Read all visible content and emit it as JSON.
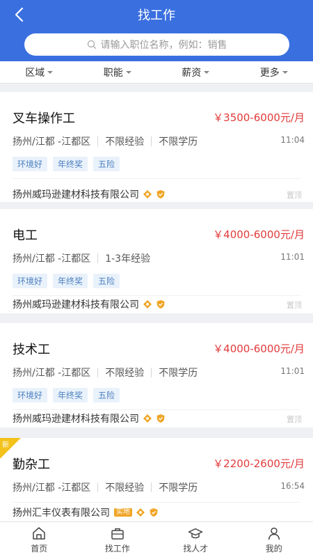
{
  "header": {
    "title": "找工作"
  },
  "search": {
    "placeholder": "请输入职位名称，例如：销售"
  },
  "filters": [
    "区域",
    "职能",
    "薪资",
    "更多"
  ],
  "jobs": [
    {
      "title": "叉车操作工",
      "salary": "￥3500-6000元/月",
      "location": "扬州/江都 -江都区",
      "experience": "不限经验",
      "education": "不限学历",
      "time": "11:04",
      "tags": [
        "环境好",
        "年终奖",
        "五险"
      ],
      "company": "扬州威玛逊建材科技有限公司",
      "pin": "置顶"
    },
    {
      "title": "电工",
      "salary": "￥4000-6000元/月",
      "location": "扬州/江都 -江都区",
      "experience": "1-3年经验",
      "time": "11:01",
      "tags": [
        "环境好",
        "年终奖",
        "五险"
      ],
      "company": "扬州威玛逊建材科技有限公司",
      "pin": "置顶"
    },
    {
      "title": "技术工",
      "salary": "￥4000-6000元/月",
      "location": "扬州/江都 -江都区",
      "experience": "不限经验",
      "education": "不限学历",
      "time": "11:01",
      "tags": [
        "环境好",
        "年终奖",
        "五险"
      ],
      "company": "扬州威玛逊建材科技有限公司",
      "pin": "置顶"
    },
    {
      "title": "勤杂工",
      "salary": "￥2200-2600元/月",
      "location": "扬州/江都 -江都区",
      "experience": "不限经验",
      "education": "不限学历",
      "time": "16:54",
      "company": "扬州汇丰仪表有限公司",
      "new_label": "新",
      "company_tag": "实地"
    }
  ],
  "tabbar": [
    "首页",
    "找工作",
    "找人才",
    "我的"
  ],
  "colors": {
    "primary": "#3a6fe0",
    "salary": "#e23a3a",
    "tag_bg": "#e9f2fb",
    "tag_text": "#4d7fbf",
    "badge": "#f0a526"
  },
  "icons": [
    "back-arrow-icon",
    "search-icon",
    "home-icon",
    "briefcase-icon",
    "graduation-cap-icon",
    "person-icon",
    "diamond-badge-icon",
    "shield-badge-icon"
  ]
}
